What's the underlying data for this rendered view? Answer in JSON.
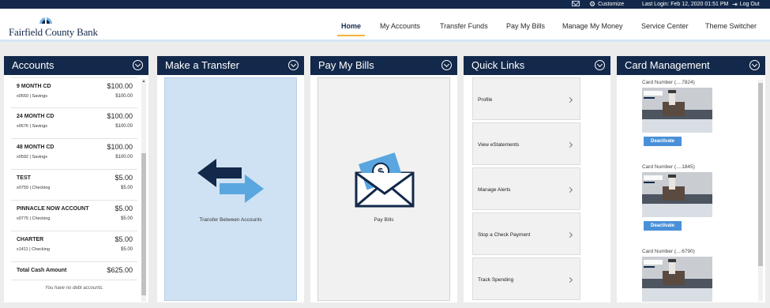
{
  "topbar": {
    "customize": "Customize",
    "last_login": "Last Login: Feb 12, 2020 01:51 PM",
    "logout": "Log Out"
  },
  "brand": {
    "name": "Fairfield County Bank"
  },
  "nav": {
    "items": [
      {
        "label": "Home",
        "active": true
      },
      {
        "label": "My Accounts"
      },
      {
        "label": "Transfer Funds"
      },
      {
        "label": "Pay My Bills"
      },
      {
        "label": "Manage My Money"
      },
      {
        "label": "Service Center"
      },
      {
        "label": "Theme Switcher"
      }
    ]
  },
  "accounts": {
    "title": "Accounts",
    "rows": [
      {
        "name": "9 MONTH CD",
        "sub": "x0550 | Savings",
        "balance": "$100.00",
        "available": "$100.00"
      },
      {
        "name": "24 MONTH CD",
        "sub": "x0576 | Savings",
        "balance": "$100.00",
        "available": "$100.00"
      },
      {
        "name": "48 MONTH CD",
        "sub": "x0592 | Savings",
        "balance": "$100.00",
        "available": "$100.00"
      },
      {
        "name": "TEST",
        "sub": "x0759 | Checking",
        "balance": "$5.00",
        "available": "$5.00"
      },
      {
        "name": "PINNACLE NOW ACCOUNT",
        "sub": "x0775 | Checking",
        "balance": "$5.00",
        "available": "$5.00"
      },
      {
        "name": "CHARTER",
        "sub": "x1411 | Checking",
        "balance": "$5.00",
        "available": "$5.00"
      }
    ],
    "total_label": "Total Cash Amount",
    "total_value": "$625.00",
    "no_debt": "You have no debt accounts."
  },
  "transfer": {
    "title": "Make a Transfer",
    "tile_label": "Transfer Between Accounts"
  },
  "bills": {
    "title": "Pay My Bills",
    "tile_label": "Pay Bills"
  },
  "quick_links": {
    "title": "Quick Links",
    "items": [
      {
        "label": "Profile"
      },
      {
        "label": "View eStatements"
      },
      {
        "label": "Manage Alerts"
      },
      {
        "label": "Stop a Check Payment"
      },
      {
        "label": "Track Spending"
      }
    ]
  },
  "cards": {
    "title": "Card Management",
    "items": [
      {
        "number": "Card Number (....7824)",
        "button": "Deactivate"
      },
      {
        "number": "Card Number (....1845)",
        "button": "Deactivate"
      },
      {
        "number": "Card Number (....6790)"
      }
    ]
  },
  "colors": {
    "navy": "#13294b",
    "accent_yellow": "#f5b335",
    "button_blue": "#4a90d9",
    "transfer_tile_bg": "#cfe2f3"
  }
}
